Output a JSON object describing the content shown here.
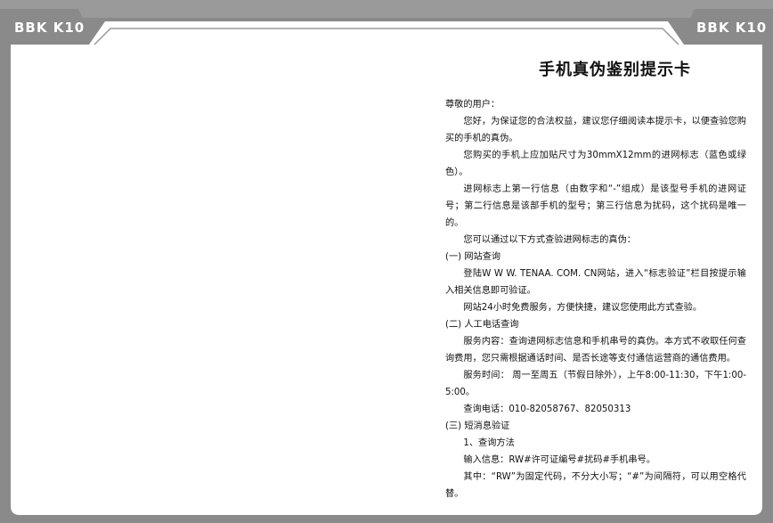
{
  "brand_left": "BBK K10",
  "brand_right": "BBK K10",
  "title": "手机真伪鉴别提示卡",
  "paragraphs": [
    {
      "text": "尊敬的用户：",
      "indent": false
    },
    {
      "text": "您好，为保证您的合法权益，建议您仔细阅读本提示卡，以便查验您购买的手机的真伪。",
      "indent": true
    },
    {
      "text": "您购买的手机上应加贴尺寸为30mmX12mm的进网标志（蓝色或绿色）。",
      "indent": true
    },
    {
      "text": "进网标志上第一行信息（由数字和“-”组成）是该型号手机的进网证号；第二行信息是该部手机的型号；第三行信息为扰码，这个扰码是唯一的。",
      "indent": true
    },
    {
      "text": "您可以通过以下方式查验进网标志的真伪：",
      "indent": true
    },
    {
      "text": "(一) 网站查询",
      "indent": false
    },
    {
      "text": "登陆W W W. TENAA. COM. CN网站，进入“标志验证”栏目按提示输入相关信息即可验证。",
      "indent": true
    },
    {
      "text": "网站24小时免费服务，方便快捷，建议您使用此方式查验。",
      "indent": true
    },
    {
      "text": "(二) 人工电话查询",
      "indent": false
    },
    {
      "text": "服务内容：查询进网标志信息和手机串号的真伪。本方式不收取任何查询费用，您只需根据通话时间、是否长途等支付通信运营商的通信费用。",
      "indent": true
    },
    {
      "text": "服务时间： 周一至周五（节假日除外），上午8:00-11:30，下午1:00-5:00。",
      "indent": true
    },
    {
      "text": "查询电话：010-82058767、82050313",
      "indent": true
    },
    {
      "text": "(三) 短消息验证",
      "indent": false
    },
    {
      "text": "1、查询方法",
      "indent": true
    },
    {
      "text": "输入信息：RW#许可证编号#扰码#手机串号。",
      "indent": true
    },
    {
      "text": "其中：“RW”为固定代码，不分大小写；“#”为间隔符，可以用空格代替。",
      "indent": true
    }
  ]
}
